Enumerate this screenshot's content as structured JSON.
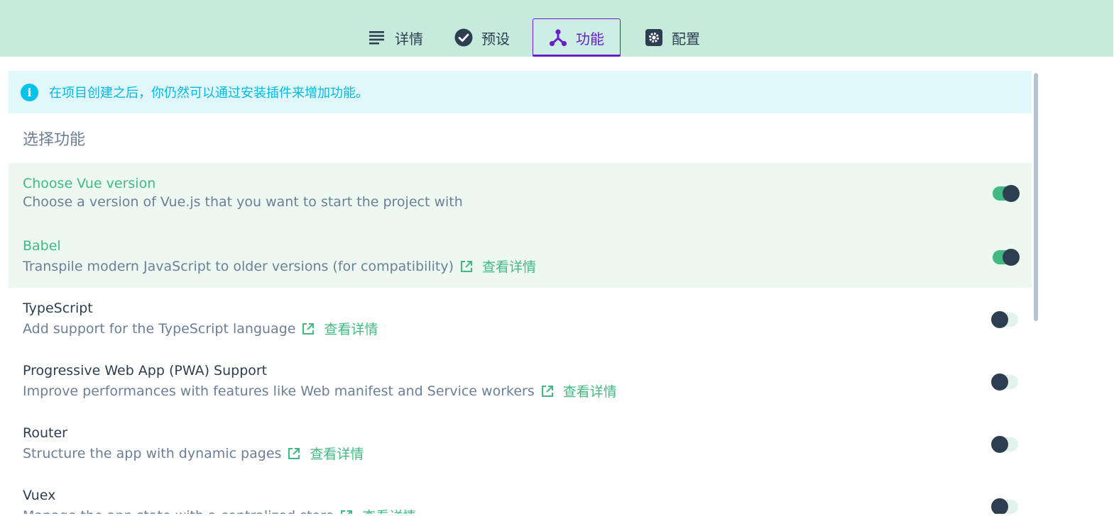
{
  "tabs": [
    {
      "label": "详情",
      "icon": "list-icon",
      "active": false
    },
    {
      "label": "预设",
      "icon": "check-circle-icon",
      "active": false
    },
    {
      "label": "功能",
      "icon": "fork-icon",
      "active": true
    },
    {
      "label": "配置",
      "icon": "gear-icon",
      "active": false
    }
  ],
  "info": {
    "text": "在项目创建之后，你仍然可以通过安装插件来增加功能。",
    "icon": "info-icon"
  },
  "section_title": "选择功能",
  "features": [
    {
      "name": "Choose Vue version",
      "desc": "Choose a version of Vue.js that you want to start the project with",
      "link": "",
      "enabled": true
    },
    {
      "name": "Babel",
      "desc": "Transpile modern JavaScript to older versions (for compatibility)",
      "link": "查看详情",
      "enabled": true
    },
    {
      "name": "TypeScript",
      "desc": "Add support for the TypeScript language",
      "link": "查看详情",
      "enabled": false
    },
    {
      "name": "Progressive Web App (PWA) Support",
      "desc": "Improve performances with features like Web manifest and Service workers",
      "link": "查看详情",
      "enabled": false
    },
    {
      "name": "Router",
      "desc": "Structure the app with dynamic pages",
      "link": "查看详情",
      "enabled": false
    },
    {
      "name": "Vuex",
      "desc": "Manage the app state with a centralized store",
      "link": "查看详情",
      "enabled": false
    }
  ],
  "colors": {
    "header_bg": "#c6ebdd",
    "accent_green": "#42b983",
    "active_tab": "#6a1ec7",
    "info_text": "#03b8e0",
    "dark": "#2c3e50"
  }
}
